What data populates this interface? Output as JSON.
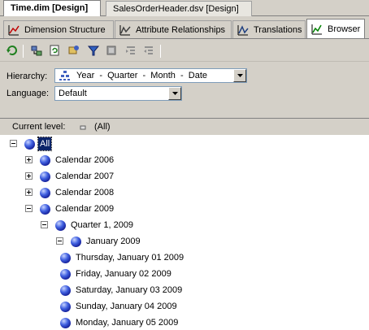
{
  "document_tabs": [
    {
      "label": "Time.dim [Design]",
      "active": true
    },
    {
      "label": "SalesOrderHeader.dsv [Design]",
      "active": false
    }
  ],
  "designer_tabs": [
    {
      "label": "Dimension Structure",
      "icon": "dimension-structure-icon",
      "active": false
    },
    {
      "label": "Attribute Relationships",
      "icon": "attribute-relationships-icon",
      "active": false
    },
    {
      "label": "Translations",
      "icon": "translations-icon",
      "active": false
    },
    {
      "label": "Browser",
      "icon": "browser-icon",
      "active": true
    }
  ],
  "toolbar": {
    "buttons": [
      "process-icon",
      "reconnect-icon",
      "refresh-icon",
      "filter-members-icon",
      "translate-icon",
      "hide-empty-icon",
      "expand-icon",
      "collapse-icon"
    ]
  },
  "hierarchy": {
    "label": "Hierarchy:",
    "value": "Year  -  Quarter  -  Month  -  Date"
  },
  "language": {
    "label": "Language:",
    "value": "Default"
  },
  "current_level": {
    "label": "Current level:",
    "value": "(All)"
  },
  "tree": [
    {
      "label": "All",
      "level": 0,
      "expander": "minus",
      "selected": true
    },
    {
      "label": "Calendar 2006",
      "level": 1,
      "expander": "plus"
    },
    {
      "label": "Calendar 2007",
      "level": 1,
      "expander": "plus"
    },
    {
      "label": "Calendar 2008",
      "level": 1,
      "expander": "plus"
    },
    {
      "label": "Calendar 2009",
      "level": 1,
      "expander": "minus"
    },
    {
      "label": "Quarter 1, 2009",
      "level": 2,
      "expander": "minus"
    },
    {
      "label": "January 2009",
      "level": 3,
      "expander": "minus"
    },
    {
      "label": "Thursday, January 01 2009",
      "level": 4,
      "expander": "none"
    },
    {
      "label": "Friday, January 02 2009",
      "level": 4,
      "expander": "none"
    },
    {
      "label": "Saturday, January 03 2009",
      "level": 4,
      "expander": "none"
    },
    {
      "label": "Sunday, January 04 2009",
      "level": 4,
      "expander": "none"
    },
    {
      "label": "Monday, January 05 2009",
      "level": 4,
      "expander": "none"
    }
  ]
}
